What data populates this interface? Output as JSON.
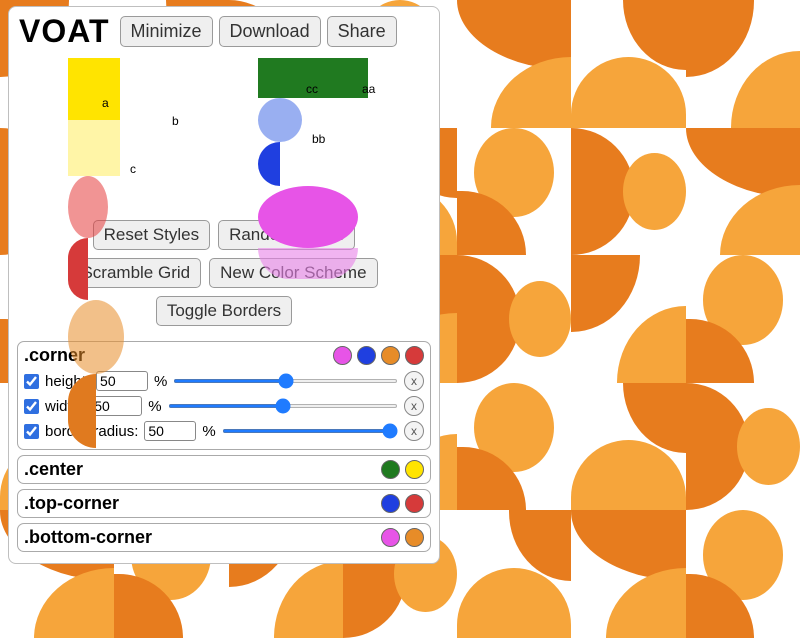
{
  "app": {
    "title": "VOAT"
  },
  "header_buttons": {
    "minimize": "Minimize",
    "download": "Download",
    "share": "Share"
  },
  "preview": {
    "p1": {
      "a": "a",
      "b": "b",
      "c": "c"
    },
    "p2": {
      "cc": "cc",
      "aa": "aa",
      "bb": "bb"
    }
  },
  "action_buttons": {
    "reset": "Reset Styles",
    "random": "Random Styles",
    "scramble": "Scramble Grid",
    "newcolors": "New Color Scheme",
    "toggleborders": "Toggle Borders"
  },
  "groups": {
    "corner": {
      "title": ".corner",
      "swatches": [
        "#e754e7",
        "#1f3fe0",
        "#e78c28",
        "#d63a3a"
      ],
      "props": [
        {
          "key": "height",
          "label": "height:",
          "value": 50,
          "unit": "%",
          "checked": true,
          "min": 0,
          "max": 100
        },
        {
          "key": "width",
          "label": "width:",
          "value": 50,
          "unit": "%",
          "checked": true,
          "min": 0,
          "max": 100
        },
        {
          "key": "border-radius",
          "label": "border-radius:",
          "value": 50,
          "unit": "%",
          "checked": true,
          "min": 0,
          "max": 50
        }
      ]
    },
    "center": {
      "title": ".center",
      "swatches": [
        "#207a20",
        "#ffe400"
      ]
    },
    "topcorner": {
      "title": ".top-corner",
      "swatches": [
        "#1f3fe0",
        "#d63a3a"
      ]
    },
    "bottomcorner": {
      "title": ".bottom-corner",
      "swatches": [
        "#e754e7",
        "#e78c28"
      ]
    }
  },
  "icons": {
    "remove": "x"
  }
}
